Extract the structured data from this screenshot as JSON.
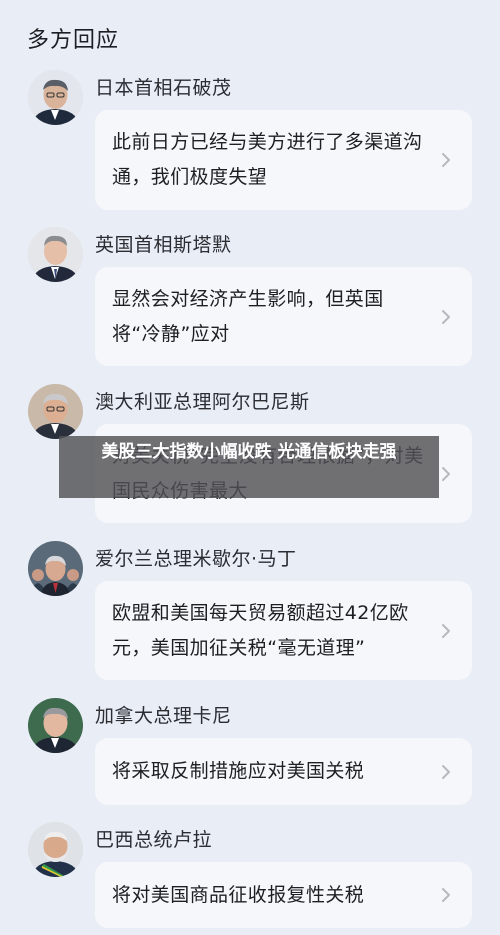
{
  "section": {
    "title": "多方回应"
  },
  "entries": [
    {
      "name": "日本首相石破茂",
      "quote": "此前日方已经与美方进行了多渠道沟通，我们极度失望"
    },
    {
      "name": "英国首相斯塔默",
      "quote": "显然会对经济产生影响，但英国将“冷静”应对"
    },
    {
      "name": "澳大利亚总理阿尔巴尼斯",
      "quote": "对美关税“完全没有合理依据”，对美国民众伤害最大"
    },
    {
      "name": "爱尔兰总理米歇尔·马丁",
      "quote": "欧盟和美国每天贸易额超过42亿欧元，美国加征关税“毫无道理”"
    },
    {
      "name": "加拿大总理卡尼",
      "quote": "将采取反制措施应对美国关税"
    },
    {
      "name": "巴西总统卢拉",
      "quote": "将对美国商品征收报复性关税"
    }
  ],
  "overlay": {
    "headline": "美股三大指数小幅收跌 光通信板块走强"
  },
  "icons": {
    "chevron": "chevron-right-icon"
  },
  "colors": {
    "background": "#e9edf5",
    "card": "#f6f7fa",
    "chevron": "#b6b9c0",
    "overlay": "#525256"
  }
}
